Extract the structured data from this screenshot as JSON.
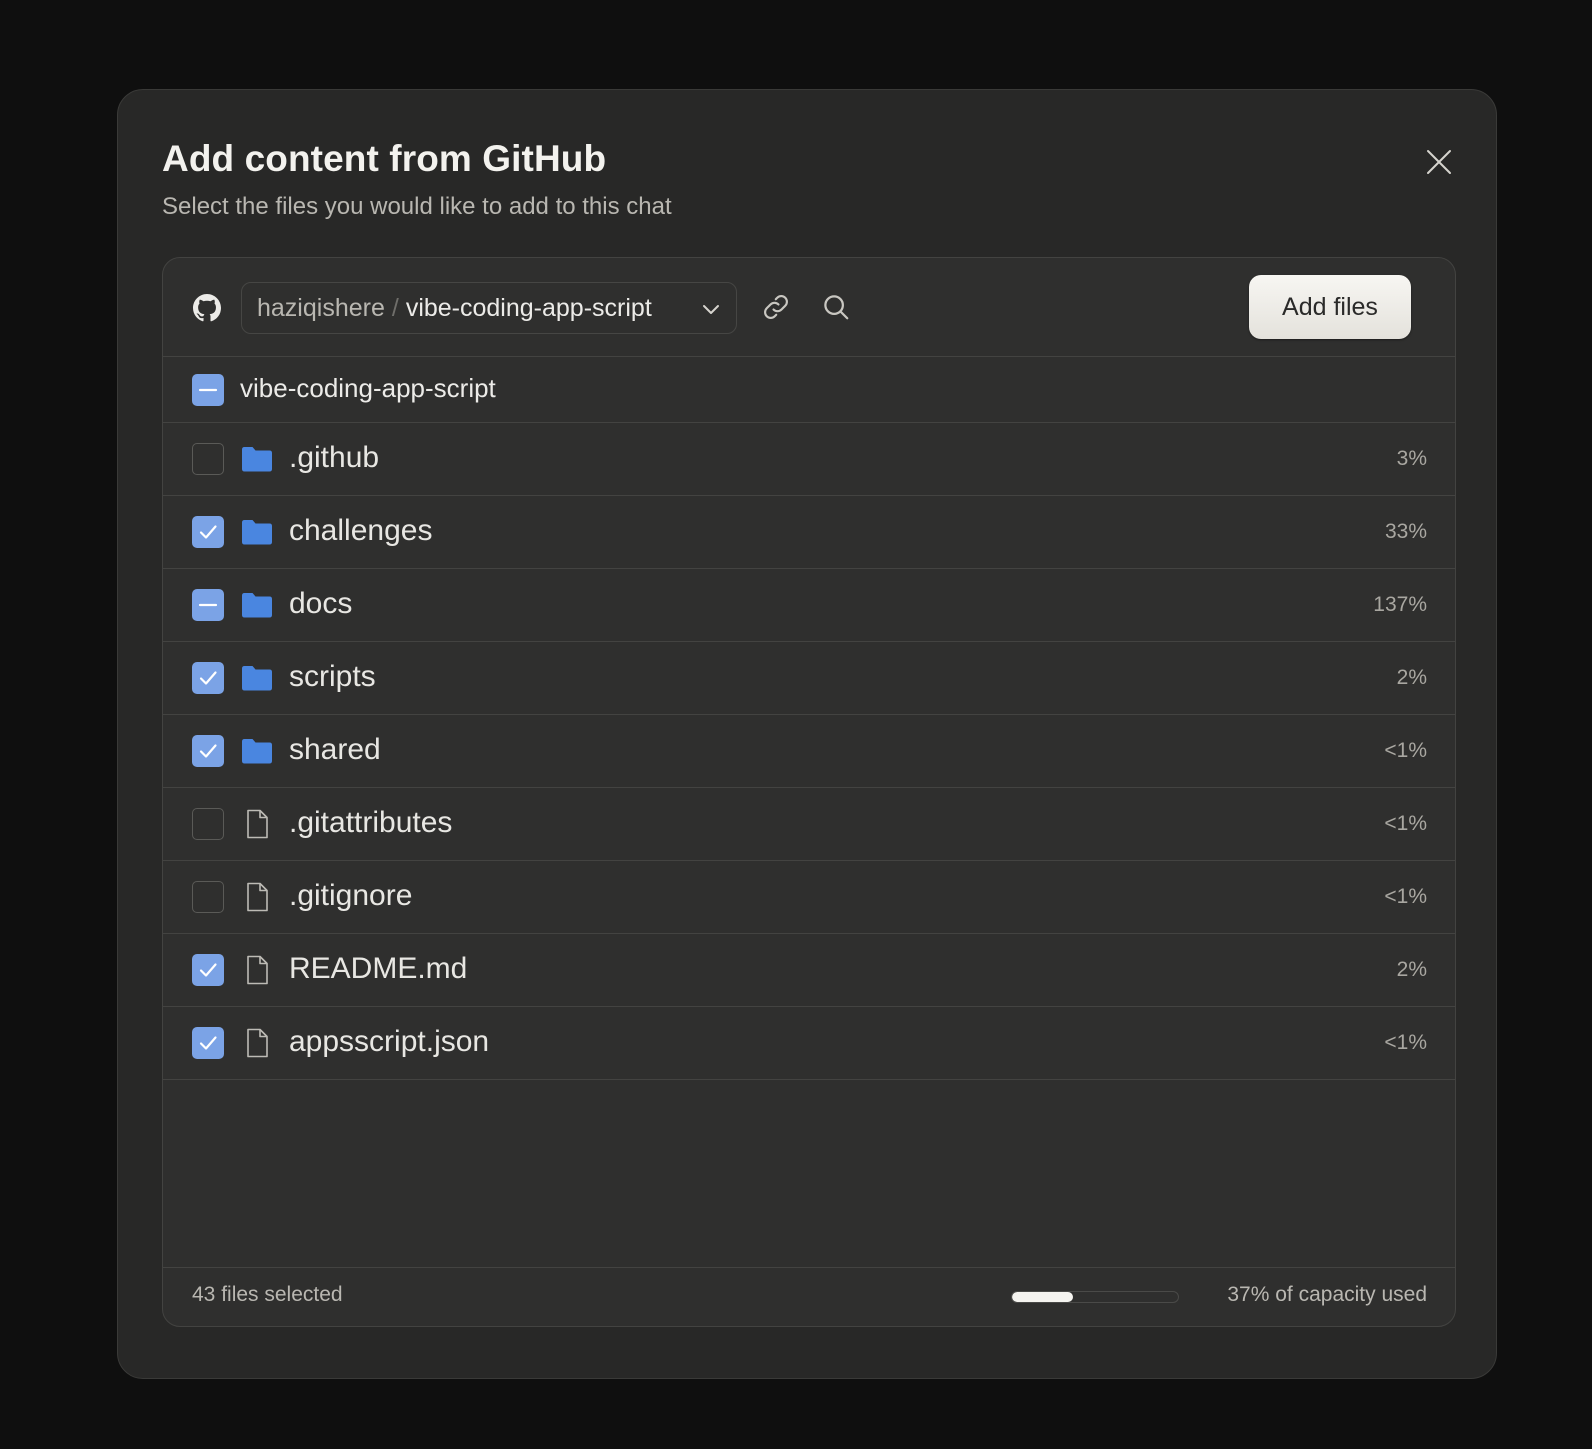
{
  "dialog": {
    "title": "Add content from GitHub",
    "subtitle": "Select the files you would like to add to this chat"
  },
  "toolbar": {
    "repo_owner": "haziqishere",
    "repo_separator": "/",
    "repo_name": "vibe-coding-app-script",
    "add_button_label": "Add files"
  },
  "root": {
    "label": "vibe-coding-app-script",
    "state": "partial"
  },
  "items": [
    {
      "name": ".github",
      "type": "folder",
      "state": "unchecked",
      "percent": "3%"
    },
    {
      "name": "challenges",
      "type": "folder",
      "state": "checked",
      "percent": "33%"
    },
    {
      "name": "docs",
      "type": "folder",
      "state": "partial",
      "percent": "137%"
    },
    {
      "name": "scripts",
      "type": "folder",
      "state": "checked",
      "percent": "2%"
    },
    {
      "name": "shared",
      "type": "folder",
      "state": "checked",
      "percent": "<1%"
    },
    {
      "name": ".gitattributes",
      "type": "file",
      "state": "unchecked",
      "percent": "<1%"
    },
    {
      "name": ".gitignore",
      "type": "file",
      "state": "unchecked",
      "percent": "<1%"
    },
    {
      "name": "README.md",
      "type": "file",
      "state": "checked",
      "percent": "2%"
    },
    {
      "name": "appsscript.json",
      "type": "file",
      "state": "checked",
      "percent": "<1%"
    }
  ],
  "footer": {
    "selected_text": "43 files selected",
    "capacity_text": "37% of capacity used",
    "capacity_fraction": 0.37
  },
  "colors": {
    "accent": "#7ba3e6",
    "folder": "#4a86e0",
    "background": "#0f0f0f",
    "dialog": "#282827",
    "panel": "#2f2f2e"
  },
  "icons": {
    "close": "close-icon",
    "github": "github-icon",
    "chevron": "chevron-down-icon",
    "link": "link-icon",
    "search": "search-icon",
    "folder": "folder-icon",
    "file": "file-icon"
  }
}
